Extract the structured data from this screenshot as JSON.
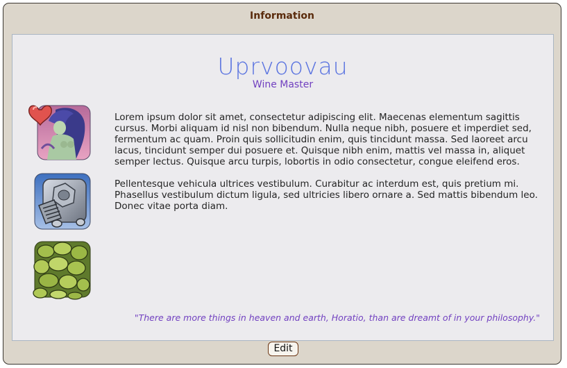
{
  "window": {
    "title": "Information"
  },
  "character": {
    "name": "Uprvoovau",
    "title": "Wine Master"
  },
  "description": {
    "paragraphs": [
      "Lorem ipsum dolor sit amet, consectetur adipiscing elit. Maecenas elementum sagittis cursus. Morbi aliquam id nisl non bibendum. Nulla neque nibh, posuere et imperdiet sed, fermentum ac quam. Proin quis sollicitudin enim, quis tincidunt massa. Sed laoreet arcu lacus, tincidunt semper dui posuere et. Quisque nibh enim, mattis vel massa in, aliquet semper lectus. Quisque arcu turpis, lobortis in odio consectetur, congue eleifend eros.",
      "Pellentesque vehicula ultrices vestibulum. Curabitur ac interdum est, quis pretium mi. Phasellus vestibulum dictum ligula, sed ultricies libero ornare a. Sed mattis bibendum leo. Donec vitae porta diam."
    ]
  },
  "quote": "\"There are more things in heaven and earth, Horatio, than are dreamt of in your philosophy.\"",
  "icons": [
    {
      "name": "mermaid-heart-portrait-icon"
    },
    {
      "name": "hex-bolt-screw-icon"
    },
    {
      "name": "mossy-rocks-icon"
    }
  ],
  "actions": {
    "edit_label": "Edit"
  },
  "colors": {
    "window_bg": "#dcd6cb",
    "panel_bg": "#ecebee",
    "title_brown": "#5a2b0c",
    "name_blue": "#5b74e0",
    "accent_purple": "#7140c0"
  }
}
